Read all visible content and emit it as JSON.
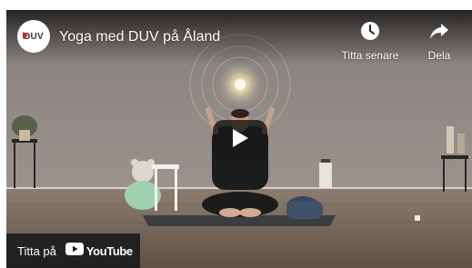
{
  "video": {
    "title": "Yoga med DUV på Åland",
    "channel_logo_text": "DUV"
  },
  "actions": {
    "watch_later_label": "Titta senare",
    "watch_later_icon": "clock-icon",
    "share_label": "Dela",
    "share_icon": "share-arrow-icon"
  },
  "player": {
    "play_icon": "play-icon",
    "watch_on_label": "Titta på",
    "youtube_label": "YouTube",
    "accent_color": "#ff0000"
  }
}
